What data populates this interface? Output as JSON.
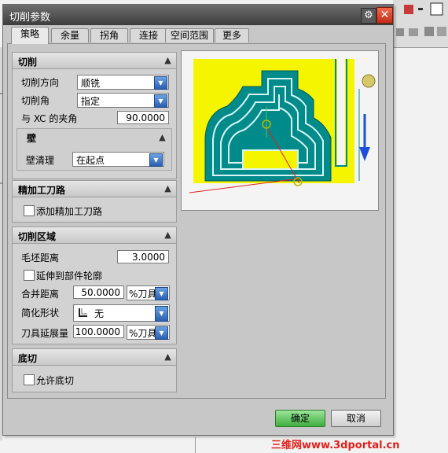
{
  "dialog": {
    "title": "切削参数"
  },
  "tabs": [
    "策略",
    "余量",
    "拐角",
    "连接",
    "空间范围",
    "更多"
  ],
  "cut_group": {
    "title": "切削",
    "direction_label": "切削方向",
    "direction_value": "顺铣",
    "angle_label": "切削角",
    "angle_value": "指定",
    "xc_angle_label": "与 XC 的夹角",
    "xc_angle_value": "90.0000",
    "wall": {
      "title": "壁",
      "cleanup_label": "壁清理",
      "cleanup_value": "在起点"
    }
  },
  "finish_group": {
    "title": "精加工刀路",
    "add_finish_label": "添加精加工刀路"
  },
  "region_group": {
    "title": "切削区域",
    "blank_distance_label": "毛坯距离",
    "blank_distance_value": "3.0000",
    "extend_label": "延伸到部件轮廓",
    "merge_distance_label": "合并距离",
    "merge_distance_value": "50.0000",
    "merge_unit": "%刀具",
    "simplify_label": "简化形状",
    "simplify_value": "无",
    "tool_ext_label": "刀具延展量",
    "tool_ext_value": "100.0000",
    "tool_ext_unit": "%刀具"
  },
  "floor_group": {
    "title": "底切",
    "allow_undercut_label": "允许底切"
  },
  "buttons": {
    "ok": "确定",
    "cancel": "取消"
  },
  "watermark": "三维网www.3dportal.cn",
  "colors": {
    "preview_fill": "#f5f500",
    "toolpath": "#008b8b",
    "direction_arrow": "#1f4fd8",
    "ok_button": "#4cbc4c"
  },
  "icons": [
    "gear-icon",
    "close-icon",
    "collapse-up-icon",
    "dropdown-arrow-icon",
    "corner-shape-icon",
    "direction-arrow-icon"
  ]
}
